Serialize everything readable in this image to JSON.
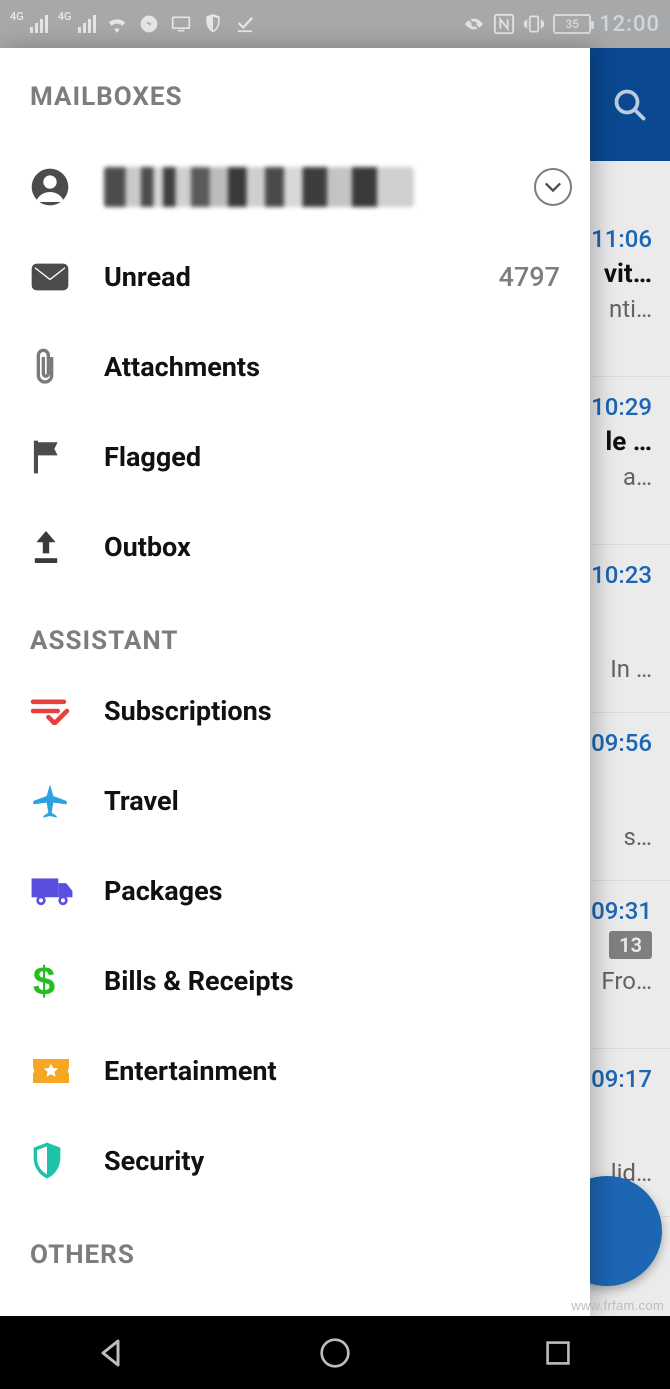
{
  "status": {
    "network_label": "4G",
    "battery_text": "35",
    "time": "12:00"
  },
  "background": {
    "rows": [
      {
        "time": "11:06",
        "subject": "vit…",
        "preview": "nti…"
      },
      {
        "time": "10:29",
        "subject": "le …",
        "preview": "a…"
      },
      {
        "time": "10:23",
        "subject": "",
        "preview": "In …"
      },
      {
        "time": "09:56",
        "subject": "",
        "preview": "s…"
      },
      {
        "time": "09:31",
        "subject": "",
        "preview": "Fro…",
        "badge": "13"
      },
      {
        "time": "09:17",
        "subject": "",
        "preview": "lid…"
      }
    ]
  },
  "drawer": {
    "sections": {
      "mailboxes_title": "MAILBOXES",
      "assistant_title": "ASSISTANT",
      "others_title": "OTHERS"
    },
    "account": {
      "name_redacted": true
    },
    "mailboxes": {
      "unread": {
        "label": "Unread",
        "count": "4797"
      },
      "attachments": {
        "label": "Attachments"
      },
      "flagged": {
        "label": "Flagged"
      },
      "outbox": {
        "label": "Outbox"
      }
    },
    "assistant": {
      "subscriptions": {
        "label": "Subscriptions"
      },
      "travel": {
        "label": "Travel"
      },
      "packages": {
        "label": "Packages"
      },
      "bills": {
        "label": "Bills & Receipts"
      },
      "entertainment": {
        "label": "Entertainment"
      },
      "security": {
        "label": "Security"
      }
    }
  },
  "watermark": "www.frfam.com"
}
